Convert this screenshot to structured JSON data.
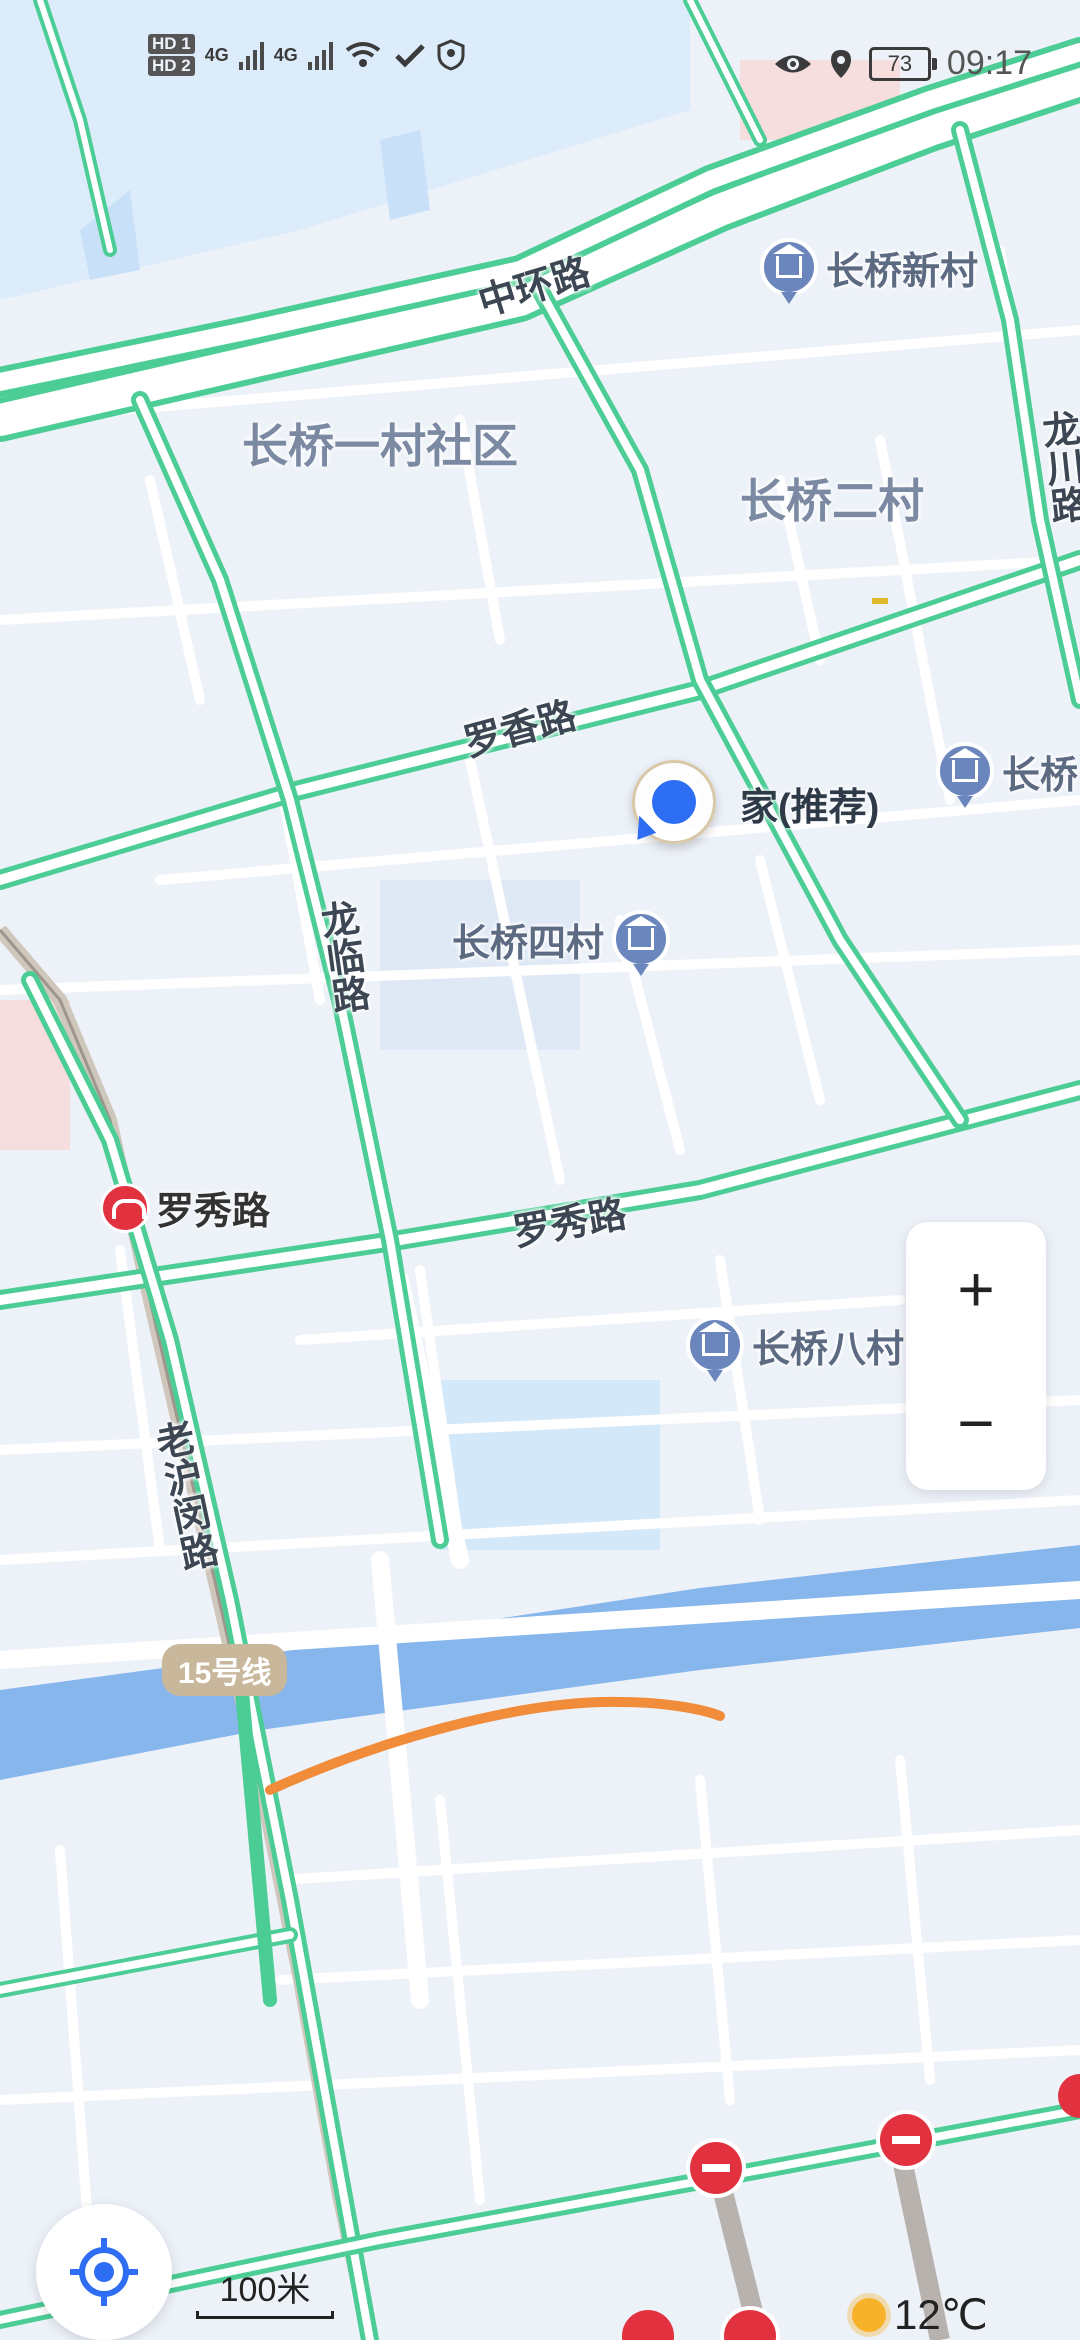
{
  "status_bar": {
    "time": "09:17",
    "battery": "73",
    "sim1": "HD 1",
    "sim2": "HD 2",
    "net1": "4G",
    "net2": "4G"
  },
  "map": {
    "areas": [
      "长桥一村社区",
      "长桥二村"
    ],
    "roads": {
      "zhonghuan": "中环路",
      "luoxiang": "罗香路",
      "longlin": "龙临路",
      "luoxiu": "罗秀路",
      "laohumin": "老沪闵路",
      "longchuan": "龙川路"
    },
    "pois": [
      {
        "label": "长桥新村",
        "icon": "residential-icon"
      },
      {
        "label": "长桥",
        "icon": "residential-icon"
      },
      {
        "label": "长桥四村",
        "icon": "residential-icon"
      },
      {
        "label": "长桥八村",
        "icon": "residential-icon"
      }
    ],
    "home_label": "家(推荐)",
    "metro_station": "罗秀路",
    "metro_line": "15号线"
  },
  "controls": {
    "zoom_in": "+",
    "zoom_out": "−",
    "scale_label": "100米",
    "temperature": "12℃"
  },
  "colors": {
    "road_edge": "#4ccd96",
    "road_fill": "#ffffff",
    "water": "#86b6ec",
    "block": "#dfe8f5",
    "accent": "#2e6ef5",
    "route": "#f08c3a",
    "metro": "#e2313f"
  }
}
